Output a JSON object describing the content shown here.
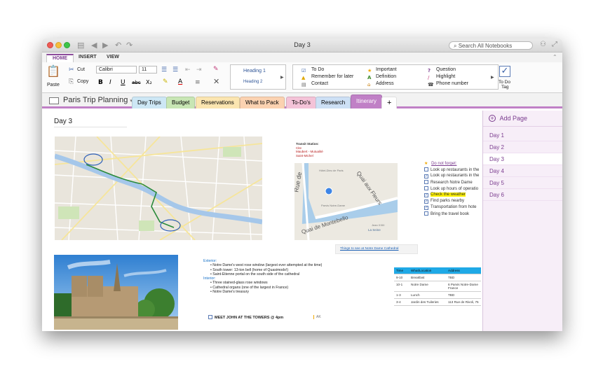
{
  "window": {
    "title": "Day 3",
    "search_placeholder": "Search All Notebooks"
  },
  "ribbon": {
    "tabs": [
      "HOME",
      "INSERT",
      "VIEW"
    ],
    "paste_label": "Paste",
    "cut_label": "Cut",
    "copy_label": "Copy",
    "font_name": "Calibri",
    "font_size": "11",
    "styles": [
      "Heading 1",
      "Heading 2"
    ],
    "tags": {
      "col1": [
        "To Do",
        "Remember for later",
        "Contact"
      ],
      "col2": [
        "Important",
        "Definition",
        "Address"
      ],
      "col3": [
        "Question",
        "Highlight",
        "Phone number"
      ]
    },
    "todo_tag_label_1": "To Do",
    "todo_tag_label_2": "Tag"
  },
  "notebook": {
    "name": "Paris Trip Planning",
    "sections": [
      {
        "label": "Day Trips",
        "color": "#cde7f5"
      },
      {
        "label": "Budget",
        "color": "#c8e6b4"
      },
      {
        "label": "Reservations",
        "color": "#fbe5b0"
      },
      {
        "label": "What to Pack",
        "color": "#fbd2b1"
      },
      {
        "label": "To-Do's",
        "color": "#f4c3d8"
      },
      {
        "label": "Research",
        "color": "#cde0f5"
      },
      {
        "label": "Itinerary",
        "color": "#c080c6"
      }
    ]
  },
  "pages": {
    "add_label": "Add Page",
    "items": [
      "Day 1",
      "Day 2",
      "Day 3",
      "Day 4",
      "Day 5",
      "Day 6"
    ],
    "active": "Day 3"
  },
  "note": {
    "title": "Day 3",
    "transit_heading": "Transit Station:",
    "transit_lines": [
      "Cite",
      "Maubert - Mutualité",
      "Saint-Michel"
    ],
    "map_labels": [
      "Rue de",
      "Hôtel-Dieu de Paris",
      "Quai aux Fleurs",
      "Quai de Montebello",
      "Parvis Notre-Dame",
      "Jean XXIII",
      "La Seine"
    ],
    "link_text": "Things to see at Notre Dame Cathedral",
    "dont_forget_heading": "Do not forget:",
    "dont_forget": [
      {
        "text": "Look up restaurants in the",
        "checked": false
      },
      {
        "text": "Look up restaurants in the",
        "checked": true
      },
      {
        "text": "Research Notre Dame",
        "checked": false
      },
      {
        "text": "Look up hours of operatio",
        "checked": false
      },
      {
        "text": "Check the weather",
        "checked": true,
        "highlight": true
      },
      {
        "text": "Find parks nearby",
        "checked": true
      },
      {
        "text": "Transportation from hote",
        "checked": true
      },
      {
        "text": "Bring the travel book",
        "checked": false
      }
    ],
    "exterior_heading": "Exterior:",
    "exterior": [
      "Notre Dame's west rose window (largest ever attempted at the time)",
      "South tower: 13-ton bell (home of Quasimodo!)",
      "Saint-Etienne portal on the south side of the cathedral"
    ],
    "interior_heading": "Interior:",
    "interior": [
      "Three stained-glass rose windows",
      "Cathedral organs (one of the largest in France)",
      "Notre Dame's treasury"
    ],
    "meet_text": "MEET JOHN AT THE TOWERS @ 4pm",
    "ak_text": "AK",
    "schedule": {
      "headers": [
        "Time",
        "What/Location",
        "Address"
      ],
      "rows": [
        [
          "9-10",
          "Breakfast",
          "TBD"
        ],
        [
          "10-1",
          "Notre Dame",
          "6 Parvis Notre-Dame France"
        ],
        [
          "1-3",
          "Lunch",
          "TBD"
        ],
        [
          "3-4",
          "Jardin des Tuileries",
          "113 Rue de Rivoli, 75"
        ]
      ]
    }
  }
}
